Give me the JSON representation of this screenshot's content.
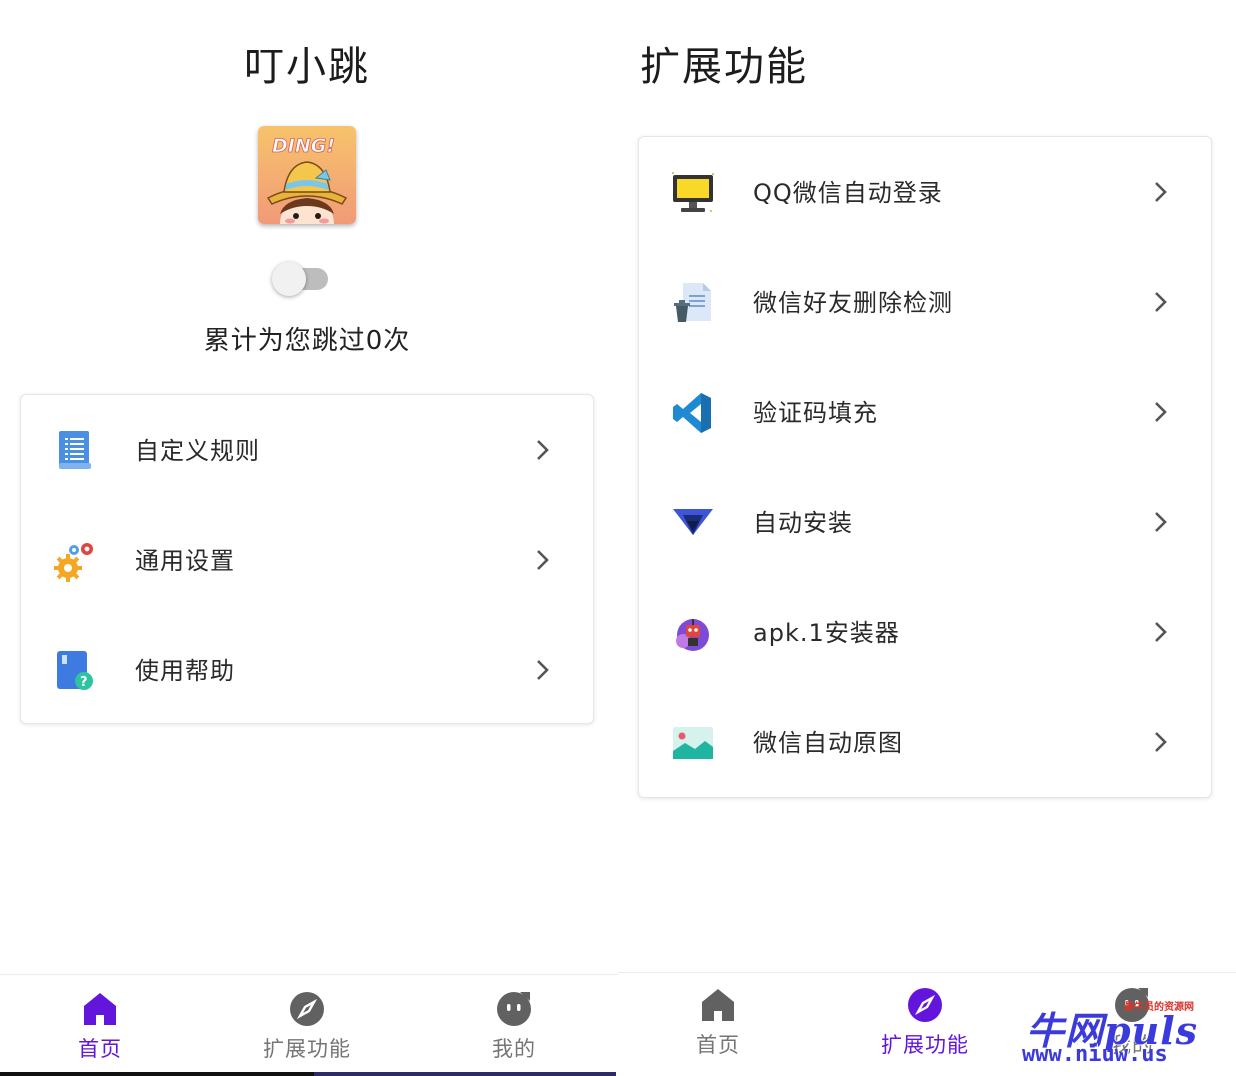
{
  "left_screen": {
    "app_title": "叮小跳",
    "logo_text": "DING!",
    "skip_count_text": "累计为您跳过0次",
    "menu": [
      {
        "label": "自定义规则",
        "icon": "document-list-icon"
      },
      {
        "label": "通用设置",
        "icon": "gears-icon"
      },
      {
        "label": "使用帮助",
        "icon": "help-book-icon"
      }
    ],
    "nav": [
      {
        "label": "首页",
        "icon": "home-icon",
        "active": true
      },
      {
        "label": "扩展功能",
        "icon": "compass-icon",
        "active": false
      },
      {
        "label": "我的",
        "icon": "face-icon",
        "active": false
      }
    ]
  },
  "right_screen": {
    "page_title": "扩展功能",
    "menu": [
      {
        "label": "QQ微信自动登录",
        "icon": "monitor-icon"
      },
      {
        "label": "微信好友删除检测",
        "icon": "document-trash-icon"
      },
      {
        "label": "验证码填充",
        "icon": "vscode-icon"
      },
      {
        "label": "自动安装",
        "icon": "triangle-install-icon"
      },
      {
        "label": "apk.1安装器",
        "icon": "robot-icon"
      },
      {
        "label": "微信自动原图",
        "icon": "landscape-image-icon"
      }
    ],
    "nav": [
      {
        "label": "首页",
        "icon": "home-icon",
        "active": false
      },
      {
        "label": "扩展功能",
        "icon": "compass-icon",
        "active": true
      },
      {
        "label": "我的",
        "icon": "face-icon",
        "active": false
      }
    ]
  },
  "watermark": {
    "main": "牛网puls",
    "small": "最牛员的资源网",
    "url": "www.niuw.us"
  },
  "colors": {
    "accent": "#6316db",
    "inactive": "#757575",
    "chevron": "#555555"
  }
}
